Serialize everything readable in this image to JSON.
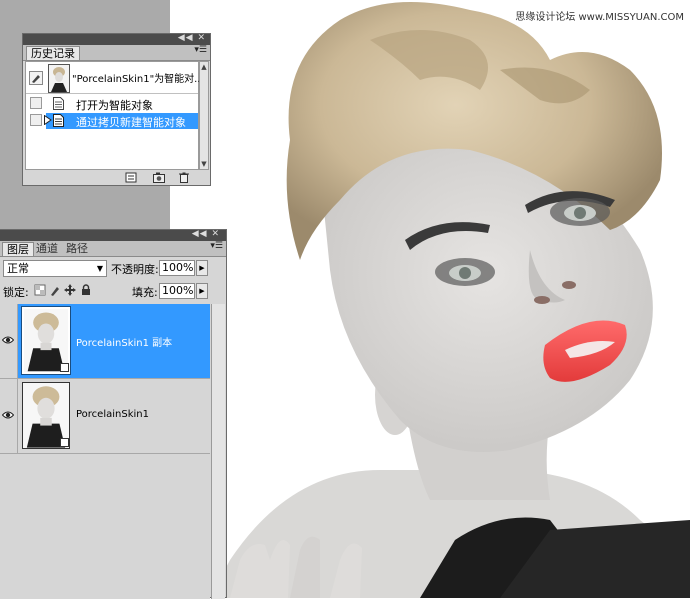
{
  "watermark": "思缘设计论坛  www.MISSYUAN.COM",
  "colors": {
    "selection": "#3399ff",
    "panel_bg": "#d6d6d6",
    "titlebar": "#4b4b4b",
    "workspace": "#aaaaaa"
  },
  "history": {
    "tab_label": "历史记录",
    "snapshot_label": "\"PorcelainSkin1\"为智能对...",
    "items": [
      {
        "label": "打开为智能对象",
        "selected": false
      },
      {
        "label": "通过拷贝新建智能对象",
        "selected": true
      }
    ],
    "footer_icons": [
      "new-document-from-state-icon",
      "camera-icon",
      "trash-icon"
    ]
  },
  "layers": {
    "tabs": [
      {
        "label": "图层",
        "active": true
      },
      {
        "label": "通道",
        "active": false
      },
      {
        "label": "路径",
        "active": false
      }
    ],
    "blend_mode": "正常",
    "opacity_label": "不透明度:",
    "opacity_value": "100%",
    "lock_label": "锁定:",
    "fill_label": "填充:",
    "fill_value": "100%",
    "lock_icons": [
      "lock-transparent-icon",
      "lock-image-icon",
      "lock-position-icon",
      "lock-all-icon"
    ],
    "list": [
      {
        "name": "PorcelainSkin1 副本",
        "selected": true,
        "visible": true
      },
      {
        "name": "PorcelainSkin1",
        "selected": false,
        "visible": true
      }
    ]
  }
}
